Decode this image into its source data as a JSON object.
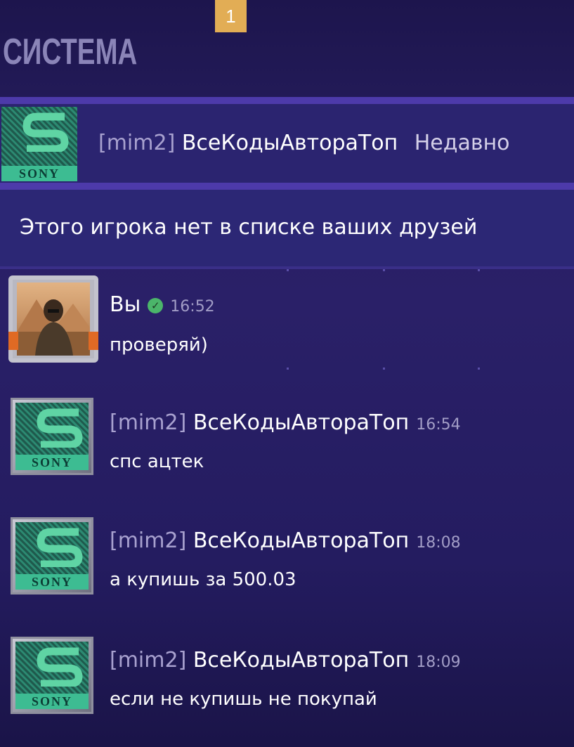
{
  "header": {
    "badge": "1",
    "title": "СИСТЕМА"
  },
  "contact": {
    "tag": "[mim2]",
    "name": "ВсеКодыАвтораТоп",
    "status": "Недавно",
    "avatar_label": "SONY"
  },
  "notice": {
    "text": "Этого игрока нет в списке ваших друзей"
  },
  "messages": [
    {
      "sender": "Вы",
      "verified_icon": "check-badge-icon",
      "time": "16:52",
      "text": "проверяй)"
    },
    {
      "tag": "[mim2]",
      "sender": "ВсеКодыАвтораТоп",
      "time": "16:54",
      "text": "спс ацтек",
      "avatar_label": "SONY"
    },
    {
      "tag": "[mim2]",
      "sender": "ВсеКодыАвтораТоп",
      "time": "18:08",
      "text": "а купишь за 500.03",
      "avatar_label": "SONY"
    },
    {
      "tag": "[mim2]",
      "sender": "ВсеКодыАвтораТоп",
      "time": "18:09",
      "text": "если не купишь не покупай",
      "avatar_label": "SONY"
    }
  ],
  "colors": {
    "background": "#261c5e",
    "badge": "#e2ad55",
    "separator": "#4d3aaa",
    "verified": "#4bb56a"
  }
}
